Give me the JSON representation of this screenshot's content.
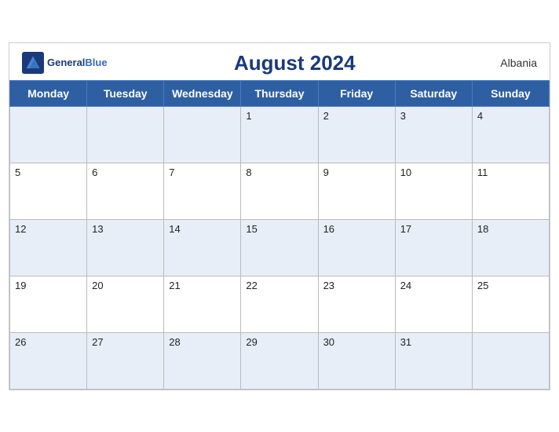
{
  "header": {
    "title": "August 2024",
    "country": "Albania",
    "logo_general": "General",
    "logo_blue": "Blue"
  },
  "weekdays": [
    "Monday",
    "Tuesday",
    "Wednesday",
    "Thursday",
    "Friday",
    "Saturday",
    "Sunday"
  ],
  "weeks": [
    [
      "",
      "",
      "",
      "1",
      "2",
      "3",
      "4"
    ],
    [
      "5",
      "6",
      "7",
      "8",
      "9",
      "10",
      "11"
    ],
    [
      "12",
      "13",
      "14",
      "15",
      "16",
      "17",
      "18"
    ],
    [
      "19",
      "20",
      "21",
      "22",
      "23",
      "24",
      "25"
    ],
    [
      "26",
      "27",
      "28",
      "29",
      "30",
      "31",
      ""
    ]
  ]
}
